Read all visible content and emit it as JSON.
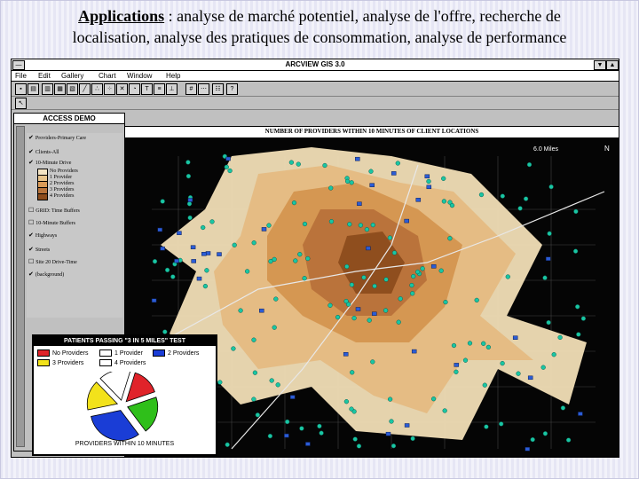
{
  "slide": {
    "title_keyword": "Applications",
    "title_rest": " : analyse de marché potentiel, analyse de l'offre, recherche de",
    "title_line2": "localisation, analyse des pratiques de consommation, analyse de performance"
  },
  "app": {
    "window_title": "ARCVIEW GIS 3.0",
    "menu": [
      "File",
      "Edit",
      "Gallery",
      "Chart",
      "Window",
      "Help"
    ],
    "panel_title": "ACCESS DEMO",
    "view_title": "NUMBER OF PROVIDERS WITHIN 10 MINUTES OF CLIENT LOCATIONS",
    "scale_label": "6.0 Miles",
    "north_label": "N",
    "help_button": "?",
    "control_minimize": "▼",
    "control_maximize": "▲"
  },
  "legend": {
    "items": [
      {
        "label": "Providers-Primary Care",
        "checked": true
      },
      {
        "label": "Clients-All",
        "checked": true
      },
      {
        "label": "10-Minute Drive",
        "checked": true
      },
      {
        "label": "No Providers"
      },
      {
        "label": "1 Provider"
      },
      {
        "label": "2 Providers"
      },
      {
        "label": "3 Providers"
      },
      {
        "label": "4 Providers"
      },
      {
        "label": "GRID: Time Buffers",
        "checked": false
      },
      {
        "label": "10-Minute Buffers",
        "checked": false
      },
      {
        "label": "Highways",
        "checked": true
      },
      {
        "label": "Streets",
        "checked": true
      },
      {
        "label": "Site 20 Drive-Time",
        "checked": false
      },
      {
        "label": "(background)",
        "checked": true
      }
    ],
    "colors": [
      "#f4e4c4",
      "#e8c48c",
      "#d89a58",
      "#b8743c",
      "#8c4c1c"
    ]
  },
  "chart": {
    "title": "PATIENTS PASSING \"3 IN 5 MILES\" TEST",
    "legend": [
      {
        "label": "No Providers",
        "color": "#e0232a"
      },
      {
        "label": "1 Provider",
        "color": "#ffffff"
      },
      {
        "label": "2 Providers",
        "color": "#1a3dd6"
      },
      {
        "label": "3 Providers",
        "color": "#f2e21b"
      },
      {
        "label": "4 Providers",
        "color": "#ffffff"
      }
    ],
    "caption": "PROVIDERS WITHIN 10 MINUTES"
  },
  "chart_data": {
    "type": "pie",
    "title": "PATIENTS PASSING \"3 IN 5 MILES\" TEST",
    "categories": [
      "No Providers",
      "1 Provider",
      "2 Providers",
      "3 Providers",
      "4 Providers"
    ],
    "values": [
      15,
      20,
      32,
      16,
      17
    ],
    "colors": [
      "#e0232a",
      "#ffffff",
      "#1a3dd6",
      "#f2e21b",
      "#ffffff"
    ],
    "slice_fill": [
      "#e0232a",
      "#2fbf1a",
      "#1a3dd6",
      "#f2e21b",
      "#ffffff"
    ]
  }
}
